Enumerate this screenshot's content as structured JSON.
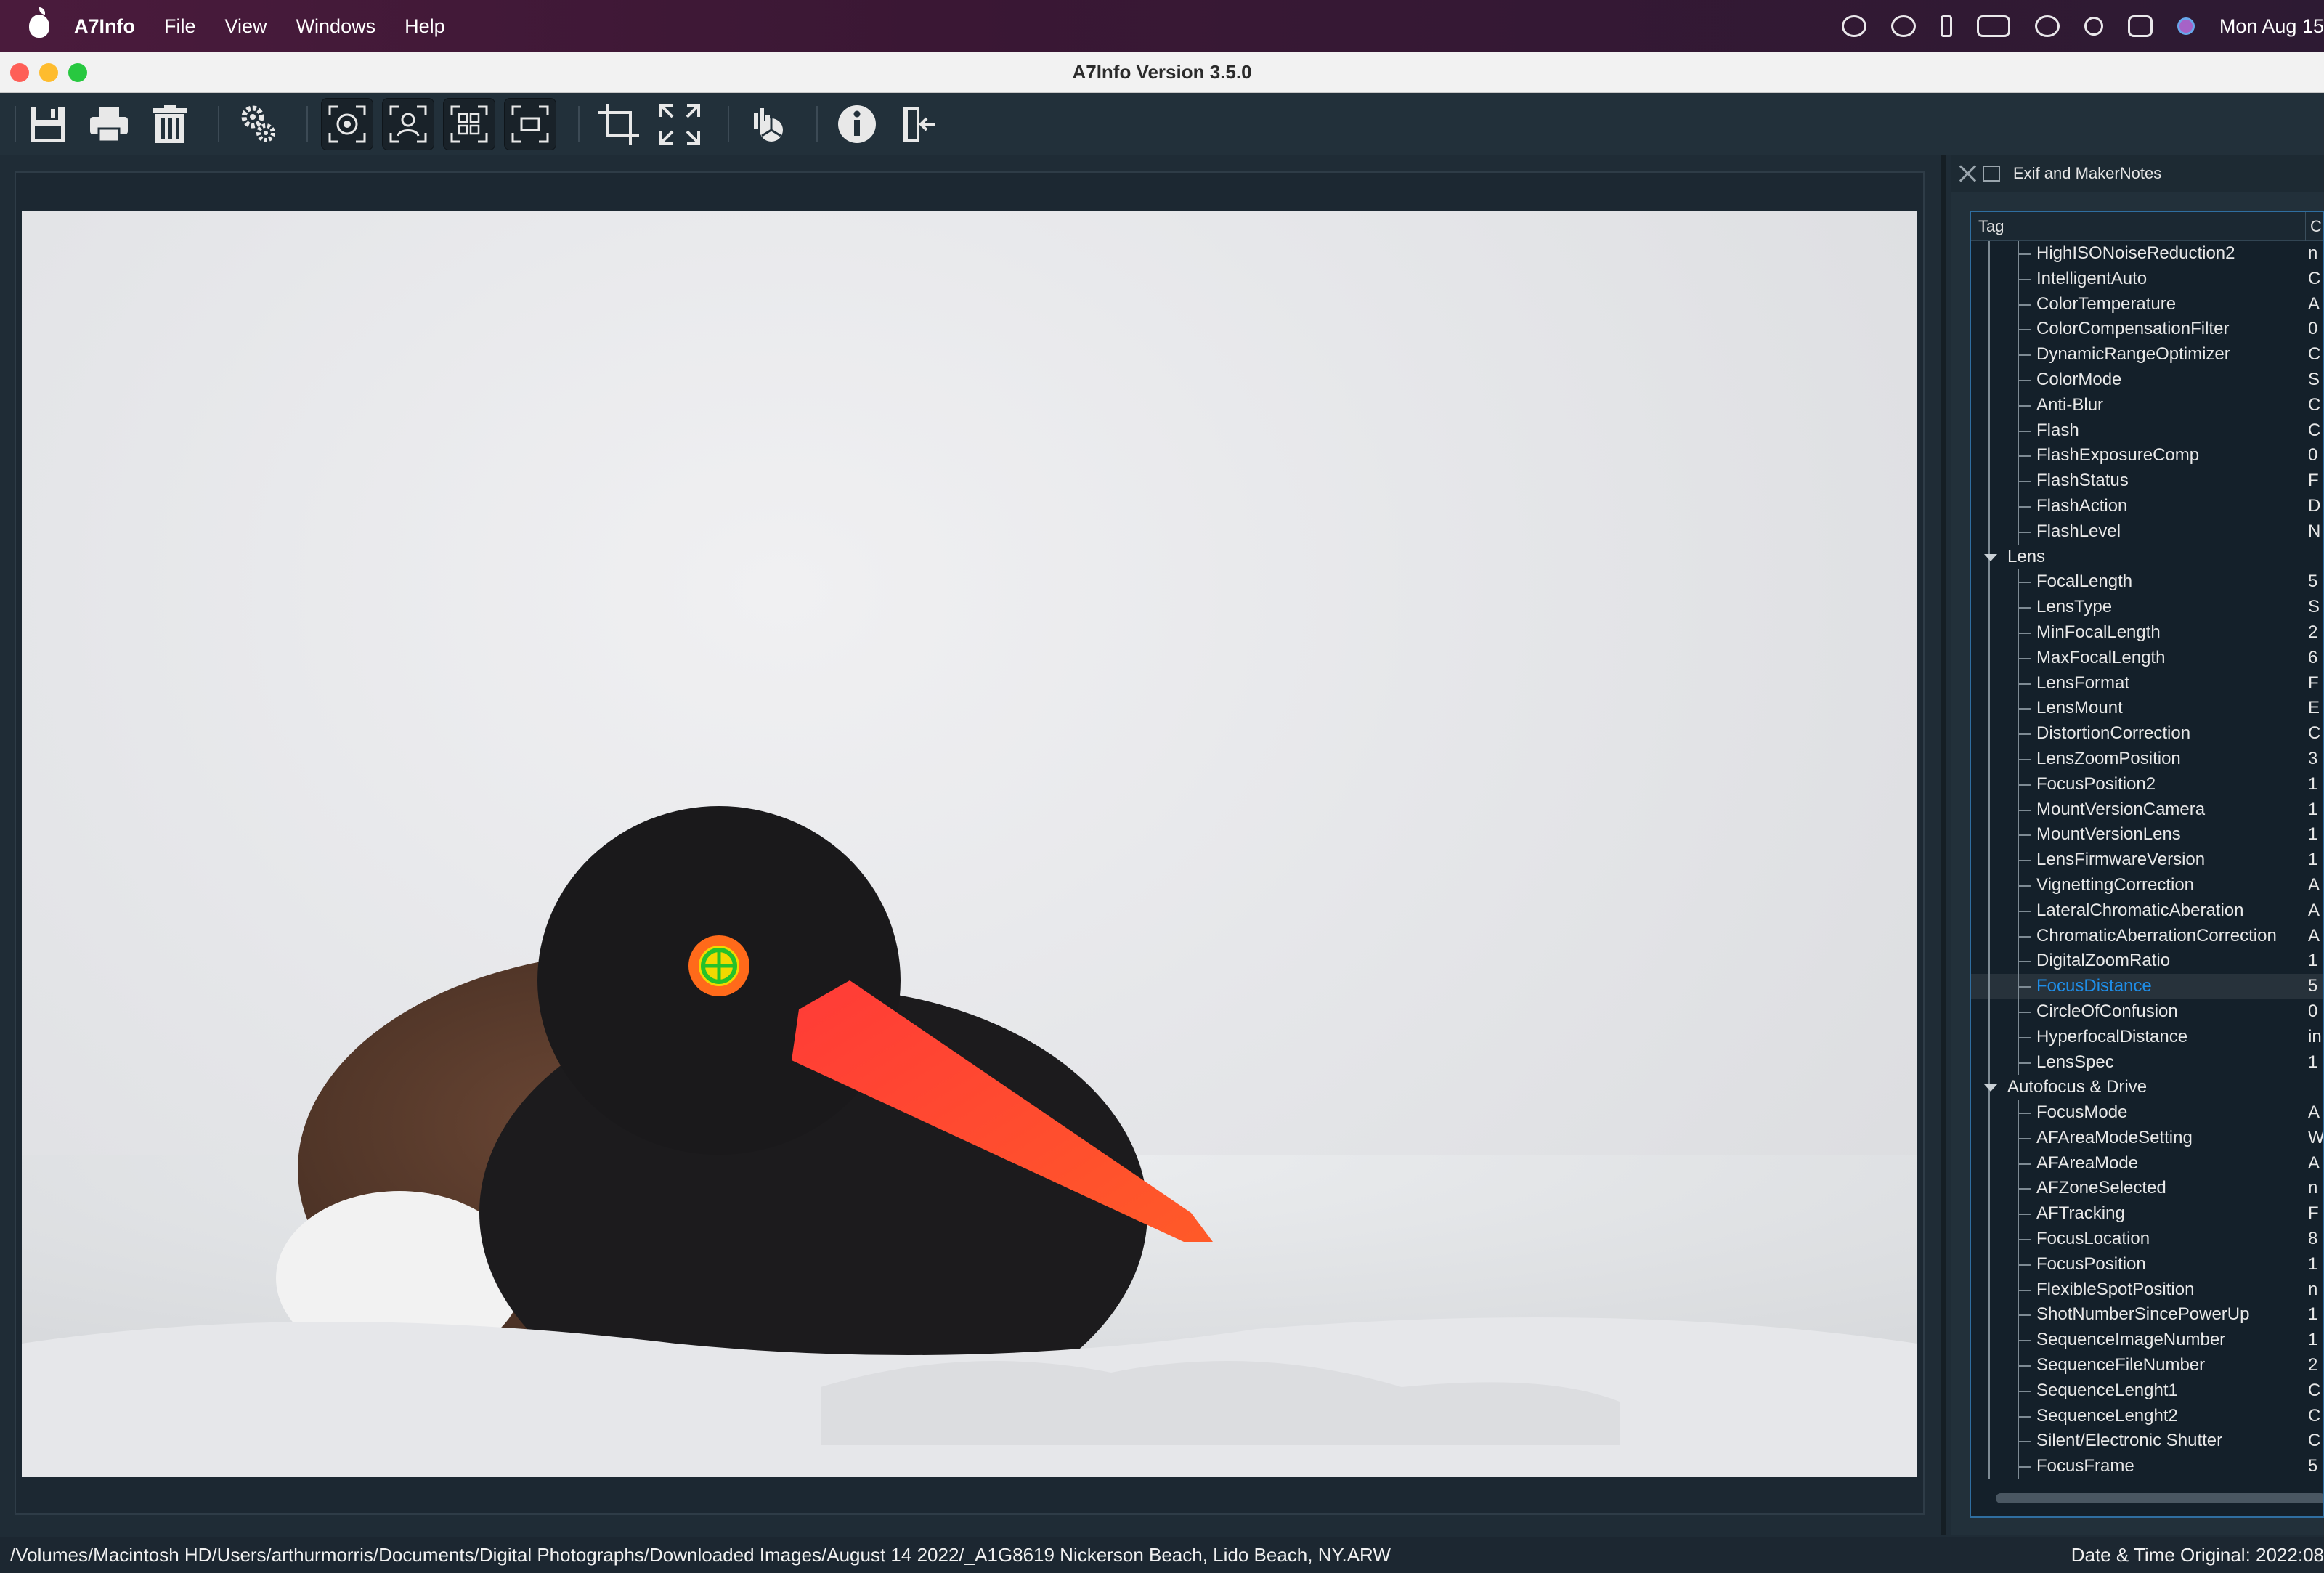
{
  "menubar": {
    "app_name": "A7Info",
    "menus": [
      "File",
      "View",
      "Windows",
      "Help"
    ],
    "clock": "Mon Aug 15"
  },
  "window": {
    "title": "A7Info Version 3.5.0"
  },
  "panel": {
    "title": "Exif and MakerNotes",
    "column_tag": "Tag",
    "column_value": "C",
    "rows": [
      {
        "label": "HighISONoiseReduction2",
        "val": "n",
        "type": "item"
      },
      {
        "label": "IntelligentAuto",
        "val": "C",
        "type": "item"
      },
      {
        "label": "ColorTemperature",
        "val": "A",
        "type": "item"
      },
      {
        "label": "ColorCompensationFilter",
        "val": "0",
        "type": "item"
      },
      {
        "label": "DynamicRangeOptimizer",
        "val": "C",
        "type": "item"
      },
      {
        "label": "ColorMode",
        "val": "S",
        "type": "item"
      },
      {
        "label": "Anti-Blur",
        "val": "C",
        "type": "item"
      },
      {
        "label": "Flash",
        "val": "C",
        "type": "item"
      },
      {
        "label": "FlashExposureComp",
        "val": "0",
        "type": "item"
      },
      {
        "label": "FlashStatus",
        "val": "F",
        "type": "item"
      },
      {
        "label": "FlashAction",
        "val": "D",
        "type": "item"
      },
      {
        "label": "FlashLevel",
        "val": "N",
        "type": "item"
      },
      {
        "label": "Lens",
        "val": "",
        "type": "group"
      },
      {
        "label": "FocalLength",
        "val": "5",
        "type": "item"
      },
      {
        "label": "LensType",
        "val": "S",
        "type": "item"
      },
      {
        "label": "MinFocalLength",
        "val": "2",
        "type": "item"
      },
      {
        "label": "MaxFocalLength",
        "val": "6",
        "type": "item"
      },
      {
        "label": "LensFormat",
        "val": "F",
        "type": "item"
      },
      {
        "label": "LensMount",
        "val": "E",
        "type": "item"
      },
      {
        "label": "DistortionCorrection",
        "val": "C",
        "type": "item"
      },
      {
        "label": "LensZoomPosition",
        "val": "3",
        "type": "item"
      },
      {
        "label": "FocusPosition2",
        "val": "1",
        "type": "item"
      },
      {
        "label": "MountVersionCamera",
        "val": "1",
        "type": "item"
      },
      {
        "label": "MountVersionLens",
        "val": "1",
        "type": "item"
      },
      {
        "label": "LensFirmwareVersion",
        "val": "1",
        "type": "item"
      },
      {
        "label": "VignettingCorrection",
        "val": "A",
        "type": "item"
      },
      {
        "label": "LateralChromaticAberation",
        "val": "A",
        "type": "item"
      },
      {
        "label": "ChromaticAberrationCorrection",
        "val": "A",
        "type": "item"
      },
      {
        "label": "DigitalZoomRatio",
        "val": "1",
        "type": "item"
      },
      {
        "label": "FocusDistance",
        "val": "5",
        "type": "item",
        "selected": true
      },
      {
        "label": "CircleOfConfusion",
        "val": "0",
        "type": "item"
      },
      {
        "label": "HyperfocalDistance",
        "val": "in",
        "type": "item"
      },
      {
        "label": "LensSpec",
        "val": "1",
        "type": "item"
      },
      {
        "label": "Autofocus & Drive",
        "val": "",
        "type": "group"
      },
      {
        "label": "FocusMode",
        "val": "A",
        "type": "item"
      },
      {
        "label": "AFAreaModeSetting",
        "val": "W",
        "type": "item"
      },
      {
        "label": "AFAreaMode",
        "val": "A",
        "type": "item"
      },
      {
        "label": "AFZoneSelected",
        "val": "n",
        "type": "item"
      },
      {
        "label": "AFTracking",
        "val": "F",
        "type": "item"
      },
      {
        "label": "FocusLocation",
        "val": "8",
        "type": "item"
      },
      {
        "label": "FocusPosition",
        "val": "1",
        "type": "item"
      },
      {
        "label": "FlexibleSpotPosition",
        "val": "n",
        "type": "item"
      },
      {
        "label": "ShotNumberSincePowerUp",
        "val": "1",
        "type": "item"
      },
      {
        "label": "SequenceImageNumber",
        "val": "1",
        "type": "item"
      },
      {
        "label": "SequenceFileNumber",
        "val": "2",
        "type": "item"
      },
      {
        "label": "SequenceLenght1",
        "val": "C",
        "type": "item"
      },
      {
        "label": "SequenceLenght2",
        "val": "C",
        "type": "item"
      },
      {
        "label": "Silent/Electronic Shutter",
        "val": "C",
        "type": "item"
      },
      {
        "label": "FocusFrame",
        "val": "5",
        "type": "item"
      }
    ]
  },
  "statusbar": {
    "path": "/Volumes/Macintosh HD/Users/arthurmorris/Documents/Digital Photographs/Downloaded Images/August 14 2022/_A1G8619 Nickerson Beach, Lido Beach, NY.ARW",
    "date": "Date & Time Original: 2022:08"
  },
  "toolbar": {
    "icons": [
      "save-icon",
      "print-icon",
      "delete-icon",
      "settings-icon",
      "focus-point-icon",
      "face-detect-icon",
      "focus-area-icon",
      "focus-frame-icon",
      "crop-icon",
      "fullscreen-icon",
      "histogram-icon",
      "info-icon",
      "exit-icon"
    ]
  },
  "colors": {
    "accent": "#1f8ee8",
    "panel_bg": "#22303a",
    "tree_border": "#2f6ea0"
  }
}
